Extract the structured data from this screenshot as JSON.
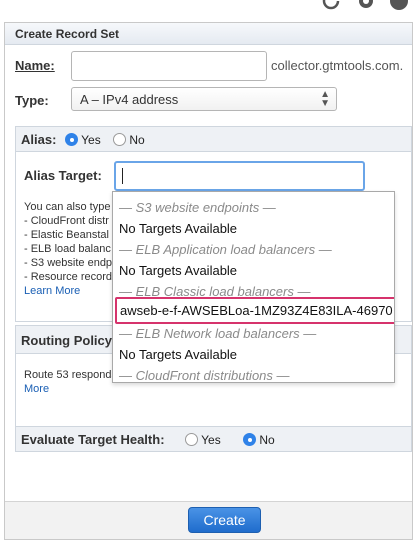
{
  "panel": {
    "title": "Create Record Set"
  },
  "name_field": {
    "label": "Name:",
    "value": "",
    "suffix": "collector.gtmtools.com."
  },
  "type_field": {
    "label": "Type:",
    "selected": "A – IPv4 address"
  },
  "alias": {
    "label": "Alias:",
    "yes_label": "Yes",
    "no_label": "No",
    "selected": "Yes"
  },
  "alias_target": {
    "label": "Alias Target:",
    "value": "",
    "help_lines": [
      "You can also type",
      "- CloudFront distr",
      "- Elastic Beanstal",
      "- ELB load balanc",
      "- S3 website endp",
      "- Resource record"
    ],
    "learn_more": "Learn More"
  },
  "dropdown": {
    "rows": [
      {
        "kind": "group",
        "text": "— S3 website endpoints —"
      },
      {
        "kind": "item",
        "text": "No Targets Available"
      },
      {
        "kind": "group",
        "text": "— ELB Application load balancers —"
      },
      {
        "kind": "item",
        "text": "No Targets Available"
      },
      {
        "kind": "group",
        "text": "— ELB Classic load balancers —"
      },
      {
        "kind": "selected",
        "text": "awseb-e-f-AWSEBLoa-1MZ93Z4E83ILA-46970"
      },
      {
        "kind": "group",
        "text": "— ELB Network load balancers —"
      },
      {
        "kind": "item",
        "text": "No Targets Available"
      },
      {
        "kind": "group",
        "text": "— CloudFront distributions —"
      }
    ]
  },
  "routing_policy": {
    "label": "Routing Policy",
    "description": "Route 53 responds",
    "more": "More"
  },
  "evaluate_health": {
    "label": "Evaluate Target Health:",
    "yes_label": "Yes",
    "no_label": "No",
    "selected": "No"
  },
  "footer": {
    "create_label": "Create"
  },
  "colors": {
    "accent": "#2f82e8",
    "highlight_border": "#d6336c",
    "button": "#1f6ccc"
  },
  "icons": [
    "refresh-icon",
    "gear-icon",
    "info-icon"
  ]
}
